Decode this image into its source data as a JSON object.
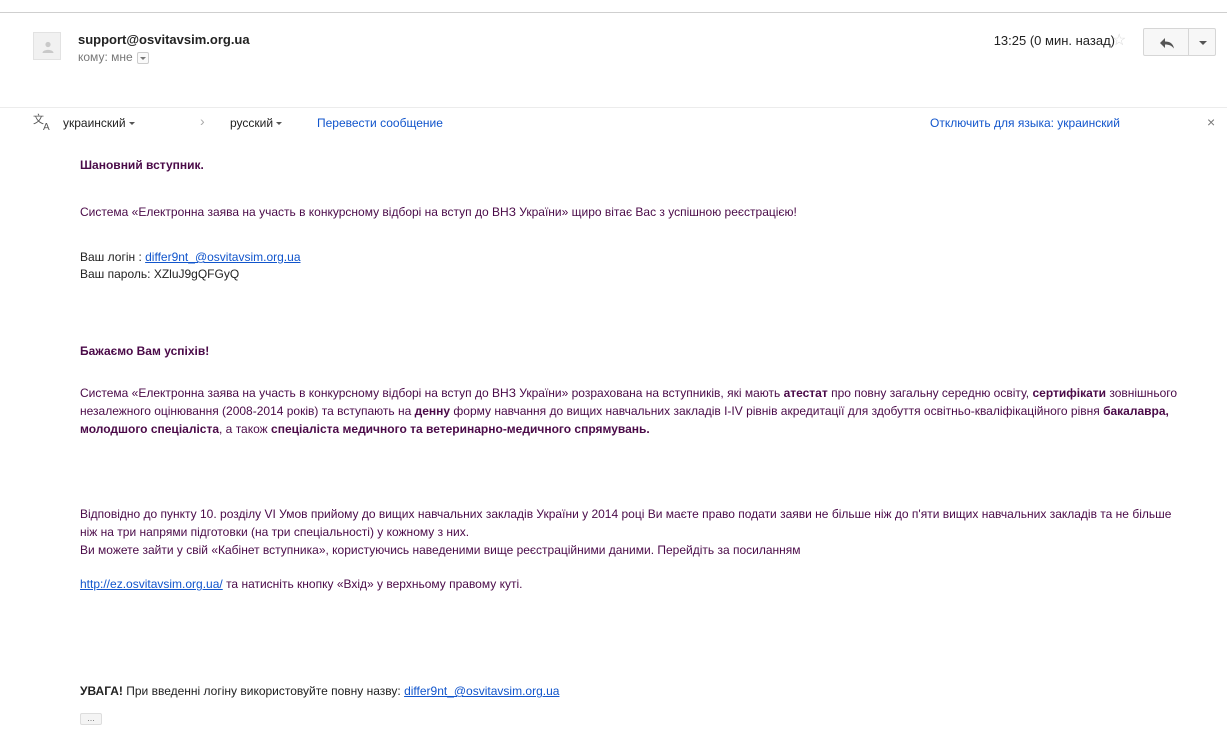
{
  "header": {
    "sender": "support@osvitavsim.org.ua",
    "to_label": "кому: мне",
    "timestamp": "13:25 (0 мин. назад)"
  },
  "translate_bar": {
    "source_lang": "украинский",
    "target_lang": "русский",
    "translate_link": "Перевести сообщение",
    "disable_link": "Отключить для языка: украинский",
    "close_symbol": "×"
  },
  "message": {
    "greeting": "Шановний вступник.",
    "welcome": "Система «Електронна заява на участь в конкурсному відборі на вступ до ВНЗ України» щиро вітає Вас з успішною реєстрацією!",
    "login_label": "Ваш логін : ",
    "login_value": "differ9nt_@osvitavsim.org.ua",
    "password_label": "Ваш пароль: ",
    "password_value": "XZluJ9gQFGyQ",
    "wish": "Бажаємо Вам успіхів!",
    "p1": {
      "t1": "Система «Електронна заява на участь в конкурсному відборі на вступ до ВНЗ України» розрахована на вступників, які мають ",
      "b1": "атестат",
      "t2": " про повну загальну середню освіту, ",
      "b2": "сертифікати",
      "t3": " зовнішнього незалежного оцінювання (2008-2014 років) та вступають на ",
      "b3": "денну",
      "t4": " форму навчання до вищих навчальних закладів I-IV рівнів акредитації для здобуття освітньо-кваліфікаційного рівня ",
      "b4": "бакалавра, молодшого спеціаліста",
      "t5": ", а також ",
      "b5": "спеціаліста медичного та ветеринарно-медичного спрямувань."
    },
    "p2": "Відповідно до пункту 10. розділу VI Умов прийому до вищих навчальних закладів України у 2014 році Ви маєте право подати заяви не більше ніж до п'яти вищих навчальних закладів та не більше ніж на три напрями підготовки (на три спеціальності) у кожному з них.",
    "p3a": "Ви можете зайти у свій «Кабінет вступника», користуючись наведеними вище реєстраційними даними. Перейдіть за посиланням",
    "p3_link": "http://ez.osvitavsim.org.ua/",
    "p3b": " та натисніть кнопку «Вхід» у верхньому правому куті.",
    "warning_bold": "УВАГА!",
    "warning_text": " При введенні логіну використовуйте повну назву: ",
    "warning_login": "differ9nt_@osvitavsim.org.ua",
    "trimmed": "..."
  },
  "icons": {
    "avatar": "person-icon",
    "star": "star-icon",
    "reply": "reply-icon",
    "more": "chevron-down-icon",
    "translate": "translate-icon"
  }
}
